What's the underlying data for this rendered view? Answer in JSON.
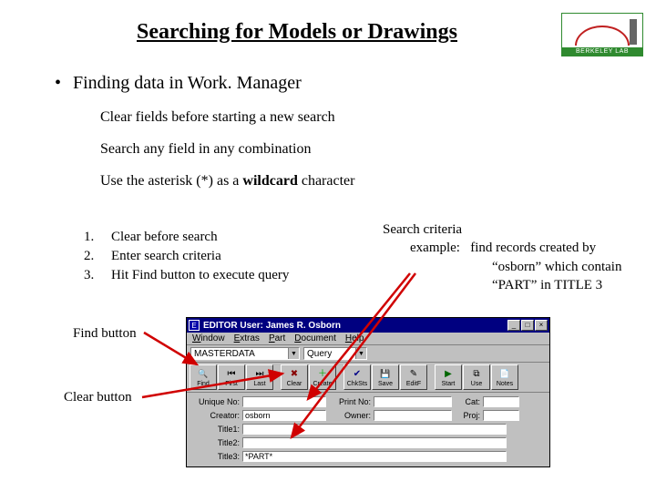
{
  "logo": {
    "text": "BERKELEY LAB"
  },
  "title": "Searching for Models or Drawings",
  "bullet": "Finding data in Work. Manager",
  "subs": {
    "a": "Clear fields before starting a new search",
    "b": "Search any field in any combination",
    "c_pre": "Use the asterisk (*) as a ",
    "c_bold": "wildcard",
    "c_post": " character"
  },
  "ol": {
    "n1": "1.",
    "t1": "Clear before search",
    "n2": "2.",
    "t2": "Enter search criteria",
    "n3": "3.",
    "t3": "Hit Find button to execute query"
  },
  "criteria": {
    "heading": "Search criteria",
    "l1a": "example:",
    "l1b": "find records created by",
    "l2": "“osborn” which contain",
    "l3": "“PART” in TITLE 3"
  },
  "labels": {
    "find": "Find button",
    "clear": "Clear button"
  },
  "editor": {
    "title": "EDITOR User: James R. Osborn",
    "menu": {
      "window": "Window",
      "extras": "Extras",
      "part": "Part",
      "document": "Document",
      "help": "Help"
    },
    "selects": {
      "table": "MASTERDATA",
      "mode": "Query"
    },
    "toolbar": {
      "find": "Find",
      "first": "First",
      "last": "Last",
      "clear": "Clear",
      "create": "Create",
      "chksts": "ChkSts",
      "save": "Save",
      "editf": "EditF",
      "start": "Start",
      "use": "Use",
      "notes": "Notes"
    },
    "form": {
      "unique_no_label": "Unique No:",
      "print_no_label": "Print No:",
      "cat_label": "Cat:",
      "creator_label": "Creator:",
      "owner_label": "Owner:",
      "proj_label": "Proj:",
      "title1_label": "Title1:",
      "title2_label": "Title2:",
      "title3_label": "Title3:",
      "creator_value": "osborn",
      "title3_value": "*PART*"
    },
    "winbtns": {
      "min": "_",
      "max": "□",
      "close": "×"
    }
  }
}
